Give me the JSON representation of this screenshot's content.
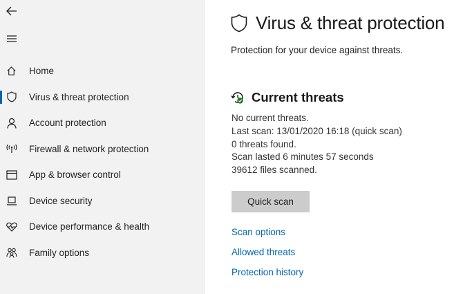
{
  "sidebar": {
    "items": [
      {
        "label": "Home",
        "icon": "home-icon"
      },
      {
        "label": "Virus & threat protection",
        "icon": "shield-icon",
        "active": true
      },
      {
        "label": "Account protection",
        "icon": "person-icon"
      },
      {
        "label": "Firewall & network protection",
        "icon": "antenna-icon"
      },
      {
        "label": "App & browser control",
        "icon": "browser-window-icon"
      },
      {
        "label": "Device security",
        "icon": "laptop-icon"
      },
      {
        "label": "Device performance & health",
        "icon": "heart-icon"
      },
      {
        "label": "Family options",
        "icon": "family-icon"
      }
    ]
  },
  "main": {
    "title": "Virus & threat protection",
    "subtitle": "Protection for your device against threats.",
    "section_title": "Current threats",
    "status": {
      "no_threats": "No current threats.",
      "last_scan": "Last scan: 13/01/2020 16:18 (quick scan)",
      "threats_found": "0 threats found.",
      "scan_duration": "Scan lasted 6 minutes 57 seconds",
      "files_scanned": "39612 files scanned."
    },
    "quick_scan_label": "Quick scan",
    "links": {
      "scan_options": "Scan options",
      "allowed_threats": "Allowed threats",
      "protection_history": "Protection history"
    }
  },
  "colors": {
    "accent": "#0063b1",
    "sidebar_bg": "#f2f2f2",
    "button_bg": "#cccccc",
    "success_green": "#107c10"
  }
}
